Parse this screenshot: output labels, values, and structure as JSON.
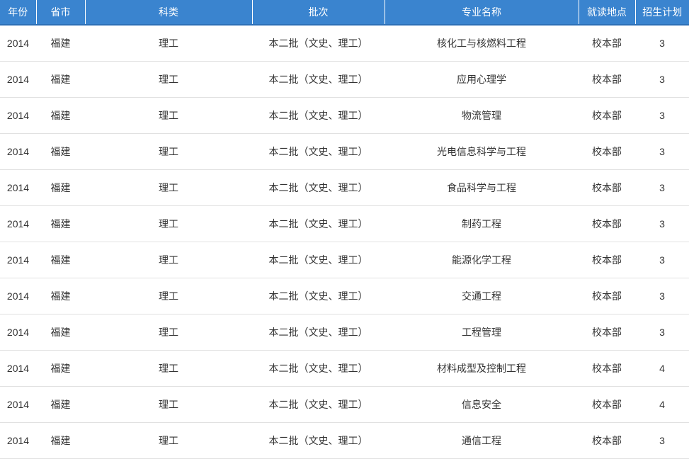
{
  "table": {
    "headers": [
      "年份",
      "省市",
      "科类",
      "批次",
      "专业名称",
      "就读地点",
      "招生计划"
    ],
    "rows": [
      [
        "2014",
        "福建",
        "理工",
        "本二批（文史、理工）",
        "核化工与核燃料工程",
        "校本部",
        "3"
      ],
      [
        "2014",
        "福建",
        "理工",
        "本二批（文史、理工）",
        "应用心理学",
        "校本部",
        "3"
      ],
      [
        "2014",
        "福建",
        "理工",
        "本二批（文史、理工）",
        "物流管理",
        "校本部",
        "3"
      ],
      [
        "2014",
        "福建",
        "理工",
        "本二批（文史、理工）",
        "光电信息科学与工程",
        "校本部",
        "3"
      ],
      [
        "2014",
        "福建",
        "理工",
        "本二批（文史、理工）",
        "食品科学与工程",
        "校本部",
        "3"
      ],
      [
        "2014",
        "福建",
        "理工",
        "本二批（文史、理工）",
        "制药工程",
        "校本部",
        "3"
      ],
      [
        "2014",
        "福建",
        "理工",
        "本二批（文史、理工）",
        "能源化学工程",
        "校本部",
        "3"
      ],
      [
        "2014",
        "福建",
        "理工",
        "本二批（文史、理工）",
        "交通工程",
        "校本部",
        "3"
      ],
      [
        "2014",
        "福建",
        "理工",
        "本二批（文史、理工）",
        "工程管理",
        "校本部",
        "3"
      ],
      [
        "2014",
        "福建",
        "理工",
        "本二批（文史、理工）",
        "材料成型及控制工程",
        "校本部",
        "4"
      ],
      [
        "2014",
        "福建",
        "理工",
        "本二批（文史、理工）",
        "信息安全",
        "校本部",
        "4"
      ],
      [
        "2014",
        "福建",
        "理工",
        "本二批（文史、理工）",
        "通信工程",
        "校本部",
        "3"
      ]
    ]
  }
}
